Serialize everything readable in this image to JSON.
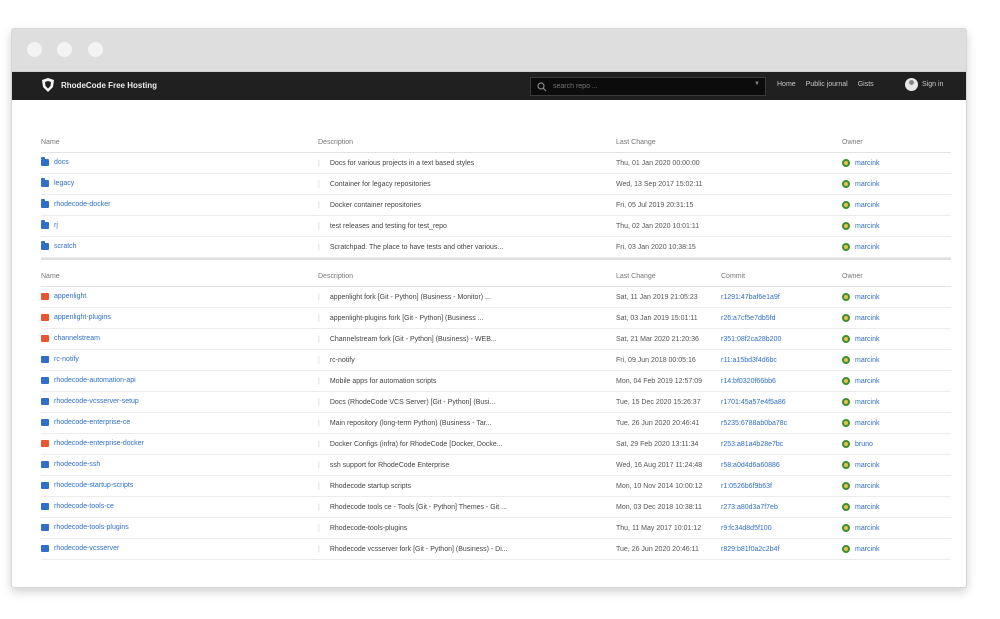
{
  "window": {
    "dot_color": "#f3f3f3"
  },
  "navbar": {
    "brand": "RhodeCode Free Hosting",
    "search_placeholder": "search repo ...",
    "links": [
      "Home",
      "Public journal",
      "Gists"
    ],
    "signin_label": "Sign in"
  },
  "groups": {
    "headers": [
      "Name",
      "Description",
      "Last Change",
      "Owner"
    ],
    "rows": [
      {
        "name": "docs",
        "description": "Docs for various projects in a text based styles",
        "last_change": "Thu, 01 Jan 2020 00:00:00",
        "owner": "marcink"
      },
      {
        "name": "legacy",
        "description": "Container for legacy repositories",
        "last_change": "Wed, 13 Sep 2017 15:02:11",
        "owner": "marcink"
      },
      {
        "name": "rhodecode-docker",
        "description": "Docker container repositories",
        "last_change": "Fri, 05 Jul 2019 20:31:15",
        "owner": "marcink"
      },
      {
        "name": "rj",
        "description": "test releases and testing for test_repo",
        "last_change": "Thu, 02 Jan 2020 10:01:11",
        "owner": "marcink"
      },
      {
        "name": "scratch",
        "description": "Scratchpad. The place to have tests and other various...",
        "last_change": "Fri, 03 Jan 2020 10:38:15",
        "owner": "marcink"
      }
    ]
  },
  "repos": {
    "headers": [
      "Name",
      "Description",
      "Last Change",
      "Commit",
      "Owner"
    ],
    "rows": [
      {
        "name": "appenlight",
        "type": "red",
        "description": "appenlight fork [Git - Python] (Business - Monitor) ...",
        "last_change": "Sat, 11 Jan 2019 21:05:23",
        "commit": "r1291:47baf6e1a9f",
        "owner": "marcink"
      },
      {
        "name": "appenlight-plugins",
        "type": "red",
        "description": "appenlight-plugins fork [Git - Python] (Business ...",
        "last_change": "Sat, 03 Jan 2019 15:01:11",
        "commit": "r26:a7cf5e7db5fd",
        "owner": "marcink"
      },
      {
        "name": "channelstream",
        "type": "red",
        "description": "Channelstream fork [Git - Python] (Business) - WEB...",
        "last_change": "Sat, 21 Mar 2020 21:20:36",
        "commit": "r351:08f2ca28b200",
        "owner": "marcink"
      },
      {
        "name": "rc-notify",
        "type": "blue",
        "description": "rc-notify",
        "last_change": "Fri, 09 Jun 2018 00:05:16",
        "commit": "r11:a15bd3f4d6bc",
        "owner": "marcink"
      },
      {
        "name": "rhodecode-automation-api",
        "type": "blue",
        "description": "Mobile apps for automation scripts",
        "last_change": "Mon, 04 Feb 2019 12:57:09",
        "commit": "r14:bf0320f66bb6",
        "owner": "marcink"
      },
      {
        "name": "rhodecode-vcsserver-setup",
        "type": "blue",
        "description": "Docs (RhodeCode VCS Server) [Git - Python] (Busi...",
        "last_change": "Tue, 15 Dec 2020 15:26:37",
        "commit": "r1701:45a57e4f5a86",
        "owner": "marcink"
      },
      {
        "name": "rhodecode-enterprise-ce",
        "type": "blue",
        "description": "Main repository (long-term Python) (Business - Tar...",
        "last_change": "Tue, 26 Jun 2020 20:46:41",
        "commit": "r5235:6788ab0ba78c",
        "owner": "marcink"
      },
      {
        "name": "rhodecode-enterprise-docker",
        "type": "red",
        "description": "Docker Configs (infra) for RhodeCode [Docker, Docke...",
        "last_change": "Sat, 29 Feb 2020 13:11:34",
        "commit": "r253:a81a4b28e7bc",
        "owner": "bruno"
      },
      {
        "name": "rhodecode-ssh",
        "type": "blue",
        "description": "ssh support for RhodeCode Enterprise",
        "last_change": "Wed, 16 Aug 2017 11:24:48",
        "commit": "r58:a0d4d6a60886",
        "owner": "marcink"
      },
      {
        "name": "rhodecode-startup-scripts",
        "type": "blue",
        "description": "Rhodecode startup scripts",
        "last_change": "Mon, 10 Nov 2014 10:00:12",
        "commit": "r1:0526b6f9b63f",
        "owner": "marcink"
      },
      {
        "name": "rhodecode-tools-ce",
        "type": "blue",
        "description": "Rhodecode tools ce - Tools [Git - Python] Themes - Git ...",
        "last_change": "Mon, 03 Dec 2018 10:38:11",
        "commit": "r273:a80d3a7f7eb",
        "owner": "marcink"
      },
      {
        "name": "rhodecode-tools-plugins",
        "type": "blue",
        "description": "Rhodecode-tools-plugins",
        "last_change": "Thu, 11 May 2017 10:01:12",
        "commit": "r9:fc34d8d5f100",
        "owner": "marcink"
      },
      {
        "name": "rhodecode-vcsserver",
        "type": "blue",
        "description": "Rhodecode vcsserver fork [Git - Python] (Business) - Di...",
        "last_change": "Tue, 26 Jun 2020 20:46:11",
        "commit": "r829:b81f0a2c2b4f",
        "owner": "marcink"
      }
    ]
  }
}
